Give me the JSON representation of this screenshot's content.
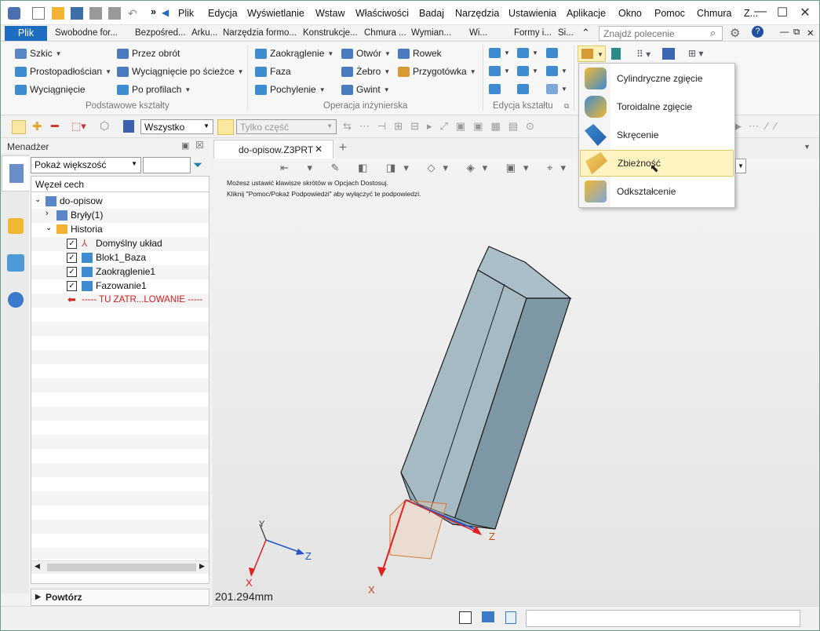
{
  "menubar": {
    "items": [
      "Plik",
      "Edycja",
      "Wyświetlanie",
      "Wstaw",
      "Właściwości",
      "Badaj",
      "Narzędzia",
      "Ustawienia",
      "Aplikacje",
      "Okno",
      "Pomoc",
      "Chmura",
      "Z..."
    ],
    "overflow": "»"
  },
  "ribbon_tabs": {
    "active": "Plik",
    "items": [
      "Swobodne for...",
      "Bezpośred...",
      "Arku...",
      "Narzędzia formo...",
      "Konstrukcje...",
      "Chmura ...",
      "Wymian...",
      "Wi...",
      "Formy i...",
      "Si..."
    ]
  },
  "search": {
    "placeholder": "Znajdź polecenie"
  },
  "ribbon": {
    "basic": {
      "label": "Podstawowe kształty",
      "items": [
        "Szkic",
        "Przez obrót",
        "Prostopadłościan",
        "Wyciągnięcie po ścieżce",
        "Wyciągnięcie",
        "Po profilach"
      ]
    },
    "eng": {
      "label": "Operacja inżynierska",
      "items": [
        "Zaokrąglenie",
        "Otwór",
        "Rowek",
        "Faza",
        "Żebro",
        "Przygotówka",
        "Pochylenie",
        "Gwint"
      ]
    },
    "edit": {
      "label": "Edycja kształtu"
    }
  },
  "toolbar": {
    "filter": "Wszystko",
    "scope": "Tylko część"
  },
  "manager": {
    "title": "Menadżer",
    "filter": "Pokaż większość",
    "header": "Węzeł cech",
    "tree": {
      "root": "do-opisow",
      "solids": "Bryły(1)",
      "history": "Historia",
      "items": [
        "Domyślny układ",
        "Blok1_Baza",
        "Zaokrąglenie1",
        "Fazowanie1"
      ],
      "rollback": "----- TU ZATR...LOWANIE -----"
    },
    "repeat": "Powtórz"
  },
  "document": {
    "tab": "do-opisow.Z3PRT"
  },
  "hints": {
    "line1": "Możesz ustawić klawisze skrótów w Opcjach Dostosuj.",
    "line2": "Kliknij \"Pomoc/Pokaż Podpowiedzi\" aby wyłączyć te podpowiedzi."
  },
  "viewport": {
    "scale": "201.294mm",
    "triad": {
      "x": "X",
      "y": "Y",
      "z": "Z"
    },
    "axis_x": "X",
    "axis_z": "Z"
  },
  "dropdown": {
    "items": [
      "Cylindryczne zgięcie",
      "Toroidalne zgięcie",
      "Skręcenie",
      "Zbieżność",
      "Odkształcenie"
    ],
    "highlighted": "Zbieżność"
  },
  "colors": {
    "accent": "#1f6dc2",
    "highlight": "#fff4c2",
    "part": "#8ea7b3",
    "axis_red": "#e02020",
    "axis_blue": "#2255cc"
  }
}
